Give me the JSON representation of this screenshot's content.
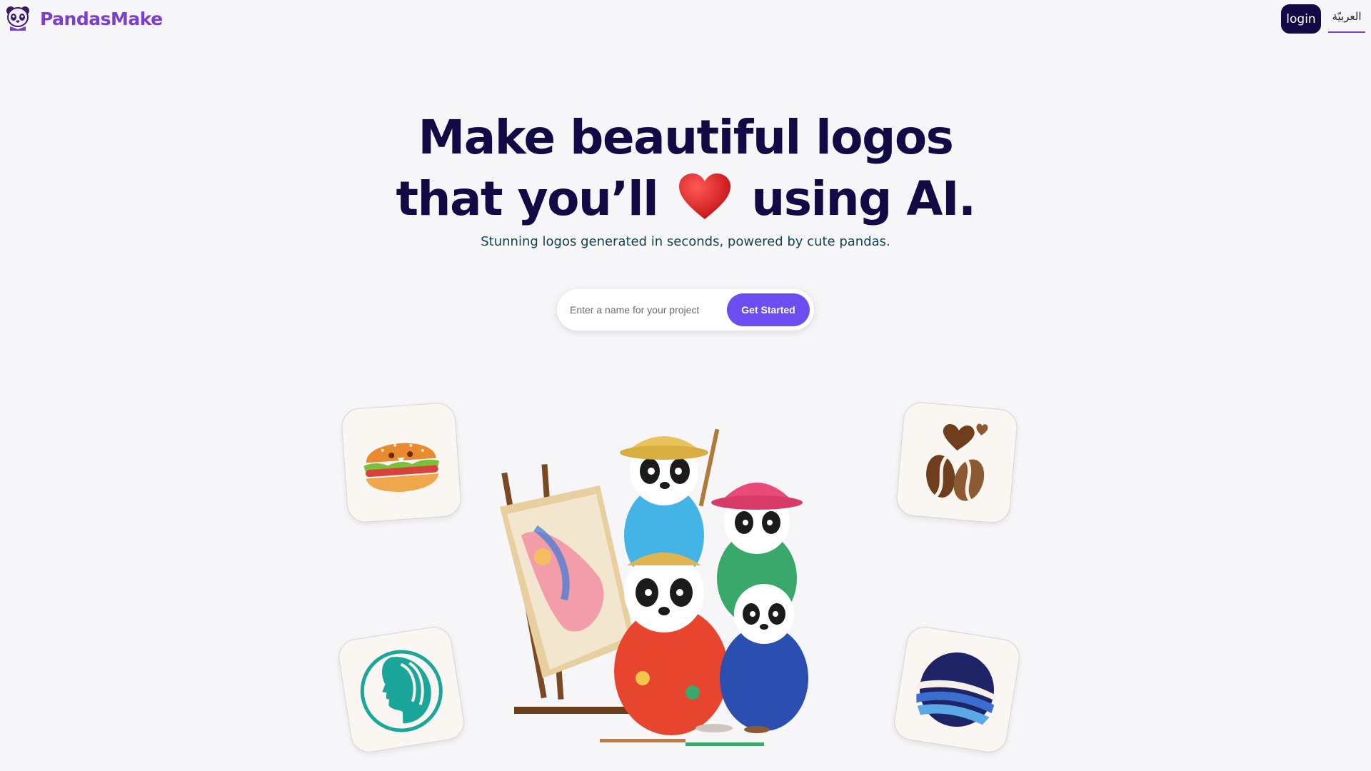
{
  "header": {
    "brand_name": "PandasMake",
    "brand_icon": "panda-logo-icon",
    "login_label": "login",
    "language_label": "العربيّة"
  },
  "hero": {
    "title_line1": "Make beautiful logos",
    "title_line2_before": "that you’ll",
    "title_line2_after": "using AI.",
    "title_icon": "heart-icon",
    "subtitle": "Stunning logos generated in seconds, powered by cute pandas."
  },
  "project_form": {
    "placeholder": "Enter a name for your project",
    "value": "",
    "button_label": "Get Started"
  },
  "showcase": {
    "tiles": [
      "burger-logo",
      "coffee-beans-heart-logo",
      "woman-profile-logo",
      "blue-waves-logo"
    ],
    "illustration": "painting-pandas-illustration"
  },
  "colors": {
    "brand": "#7b3fd0",
    "navy": "#110a44",
    "accent": "#6c4ef0",
    "background": "#f6f6f8"
  }
}
